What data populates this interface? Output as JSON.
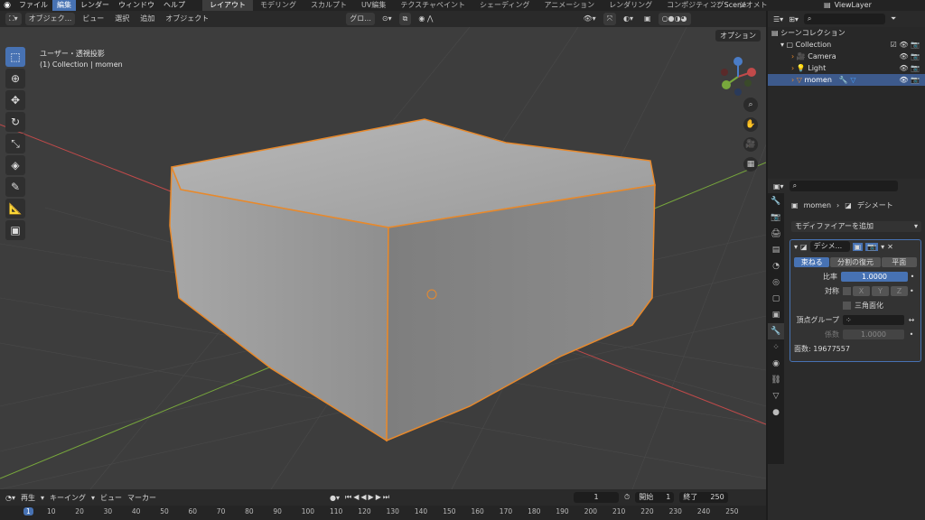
{
  "topbar": {
    "menus": [
      "ファイル",
      "編集",
      "レンダー",
      "ウィンドウ",
      "ヘルプ"
    ],
    "active_menu": "編集",
    "workspaces": [
      "レイアウト",
      "モデリング",
      "スカルプト",
      "UV編集",
      "テクスチャペイント",
      "シェーディング",
      "アニメーション",
      "レンダリング",
      "コンポジティング",
      "ジオメト"
    ],
    "active_workspace": "レイアウト",
    "scene": "Scene",
    "view_layer": "ViewLayer"
  },
  "viewport_header": {
    "mode": "オブジェク...",
    "view": "ビュー",
    "select": "選択",
    "add": "追加",
    "object": "オブジェクト",
    "transform": "グロ..."
  },
  "viewport": {
    "view_name": "ユーザー・透視投影",
    "collection_info": "(1) Collection | momen",
    "options": "オプション"
  },
  "outliner": {
    "title": "シーンコレクション",
    "collection": "Collection",
    "items": [
      "Camera",
      "Light",
      "momen"
    ],
    "selected": "momen"
  },
  "properties": {
    "breadcrumb_object": "momen",
    "breadcrumb_modifier": "デシメート",
    "add_modifier": "モディファイアーを追加",
    "modifier": {
      "name": "デシメ...",
      "tabs": [
        "束ねる",
        "分割の復元",
        "平面"
      ],
      "ratio_label": "比率",
      "ratio_value": "1.0000",
      "sym_label": "対称",
      "axes": [
        "X",
        "Y",
        "Z"
      ],
      "triangulate": "三角面化",
      "vgroup_label": "頂点グループ",
      "factor_label": "係数",
      "factor_value": "1.0000",
      "face_count": "面数: 19677557"
    }
  },
  "timeline": {
    "play": "再生",
    "keying": "キーイング",
    "view": "ビュー",
    "marker": "マーカー",
    "current_frame": "1",
    "start_label": "開始",
    "start": "1",
    "end_label": "終了",
    "end": "250",
    "ticks": [
      "1",
      "10",
      "20",
      "30",
      "40",
      "50",
      "60",
      "70",
      "80",
      "90",
      "100",
      "110",
      "120",
      "130",
      "140",
      "150",
      "160",
      "170",
      "180",
      "190",
      "200",
      "210",
      "220",
      "230",
      "240",
      "250"
    ]
  },
  "colors": {
    "accent": "#4772b3",
    "selection_outline": "#e8892b",
    "x_axis": "#c14a4a",
    "y_axis": "#78a83c"
  }
}
